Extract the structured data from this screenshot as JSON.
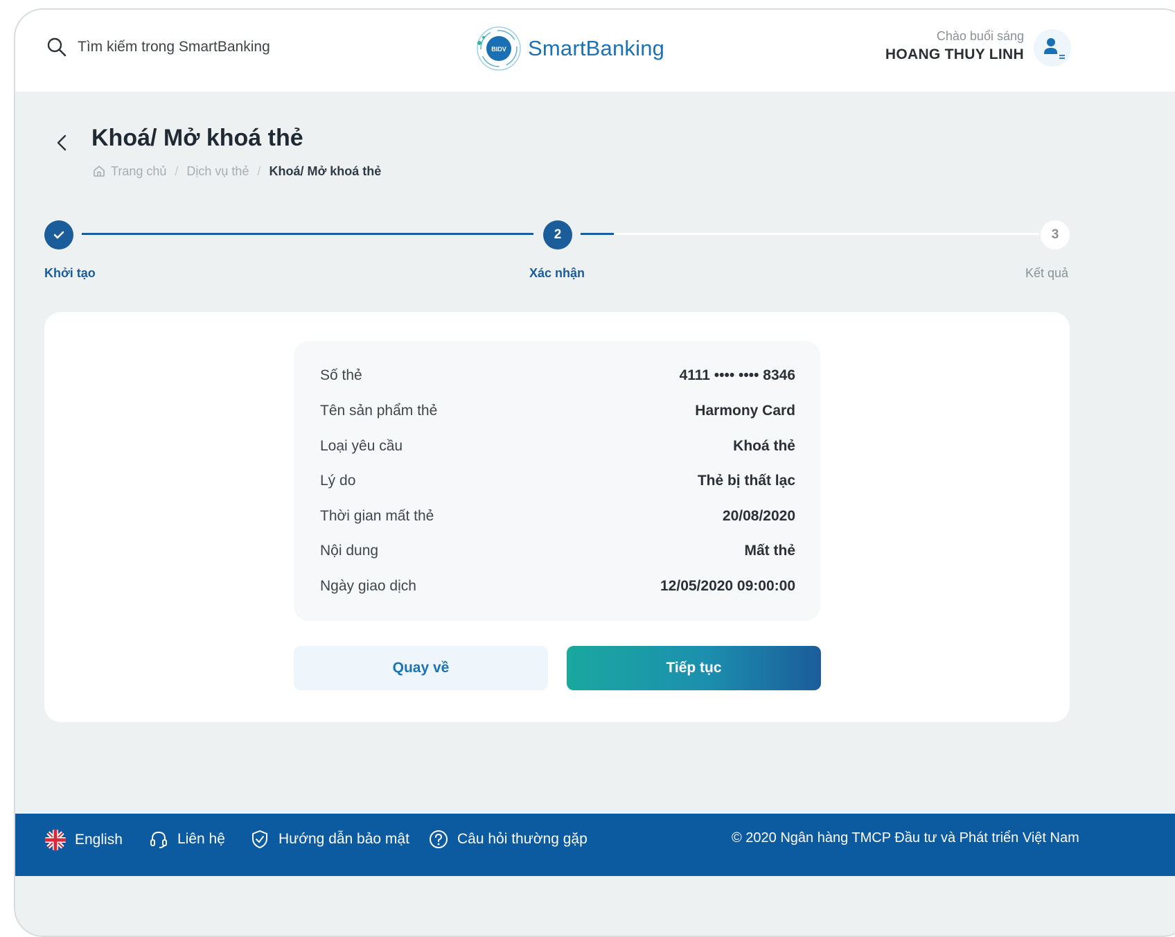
{
  "header": {
    "search_placeholder": "Tìm kiếm trong SmartBanking",
    "brand_badge": "BIDV",
    "brand_name": "SmartBanking",
    "greeting": "Chào buổi sáng",
    "user_name": "HOANG THUY LINH"
  },
  "page": {
    "title": "Khoá/ Mở khoá thẻ",
    "breadcrumb": [
      "Trang chủ",
      "Dịch vụ thẻ",
      "Khoá/ Mở khoá thẻ"
    ]
  },
  "stepper": {
    "steps": [
      {
        "label": "Khởi tạo",
        "state": "done"
      },
      {
        "number": "2",
        "label": "Xác nhận",
        "state": "active"
      },
      {
        "number": "3",
        "label": "Kết quả",
        "state": "pending"
      }
    ]
  },
  "details": [
    {
      "label": "Số thẻ",
      "value": "4111 •••• •••• 8346"
    },
    {
      "label": "Tên sản phẩm thẻ",
      "value": "Harmony Card"
    },
    {
      "label": "Loại yêu cầu",
      "value": "Khoá thẻ"
    },
    {
      "label": "Lý do",
      "value": "Thẻ bị thất lạc"
    },
    {
      "label": "Thời gian mất thẻ",
      "value": "20/08/2020"
    },
    {
      "label": "Nội dung",
      "value": "Mất thẻ"
    },
    {
      "label": "Ngày giao dịch",
      "value": "12/05/2020 09:00:00"
    }
  ],
  "actions": {
    "back_label": "Quay về",
    "next_label": "Tiếp tục"
  },
  "footer": {
    "language": "English",
    "contact": "Liên hệ",
    "security": "Hướng dẫn bảo mật",
    "faq": "Câu hỏi thường gặp",
    "copyright": "© 2020 Ngân hàng TMCP Đầu tư và Phát triển Việt Nam"
  },
  "colors": {
    "primary": "#1b5c9a",
    "accent_teal": "#1aa89f",
    "footer_bg": "#0c5aa0",
    "page_bg": "#eef1f2"
  }
}
